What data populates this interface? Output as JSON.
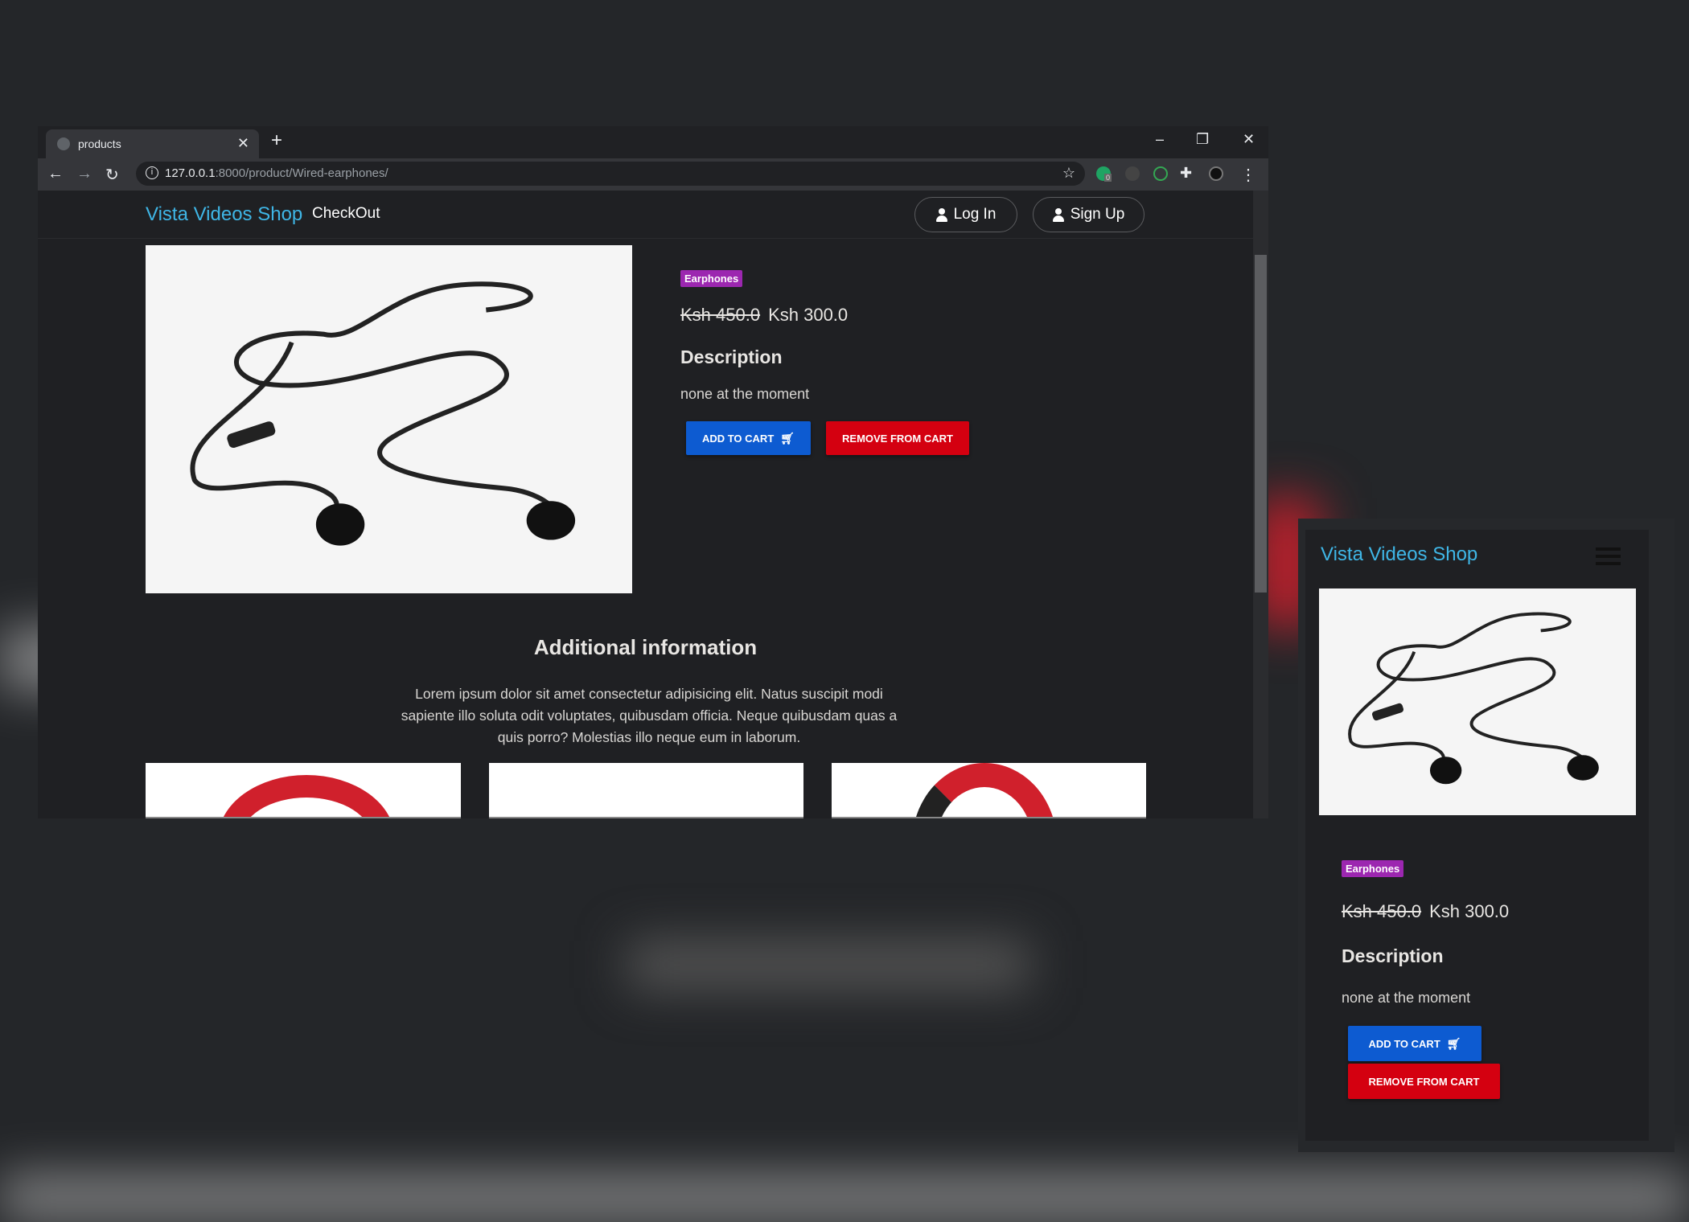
{
  "browser": {
    "tab_title": "products",
    "url_host": "127.0.0.1",
    "url_path": ":8000/product/Wired-earphones/",
    "extension_badge": "0"
  },
  "navbar": {
    "brand": "Vista Videos Shop",
    "checkout": "CheckOut",
    "login": "Log In",
    "signup": "Sign Up"
  },
  "product": {
    "category": "Earphones",
    "old_price": "Ksh 450.0",
    "price": "Ksh 300.0",
    "description_heading": "Description",
    "description": "none at the moment",
    "add_to_cart": "ADD TO CART",
    "remove_from_cart": "REMOVE FROM CART"
  },
  "additional": {
    "heading": "Additional information",
    "text": "Lorem ipsum dolor sit amet consectetur adipisicing elit. Natus suscipit modi sapiente illo soluta odit voluptates, quibusdam officia. Neque quibusdam quas a quis porro? Molestias illo neque eum in laborum."
  },
  "colors": {
    "brand": "#3fb6e6",
    "badge": "#9c27b0",
    "add_button": "#0d5bd1",
    "remove_button": "#d40010"
  }
}
